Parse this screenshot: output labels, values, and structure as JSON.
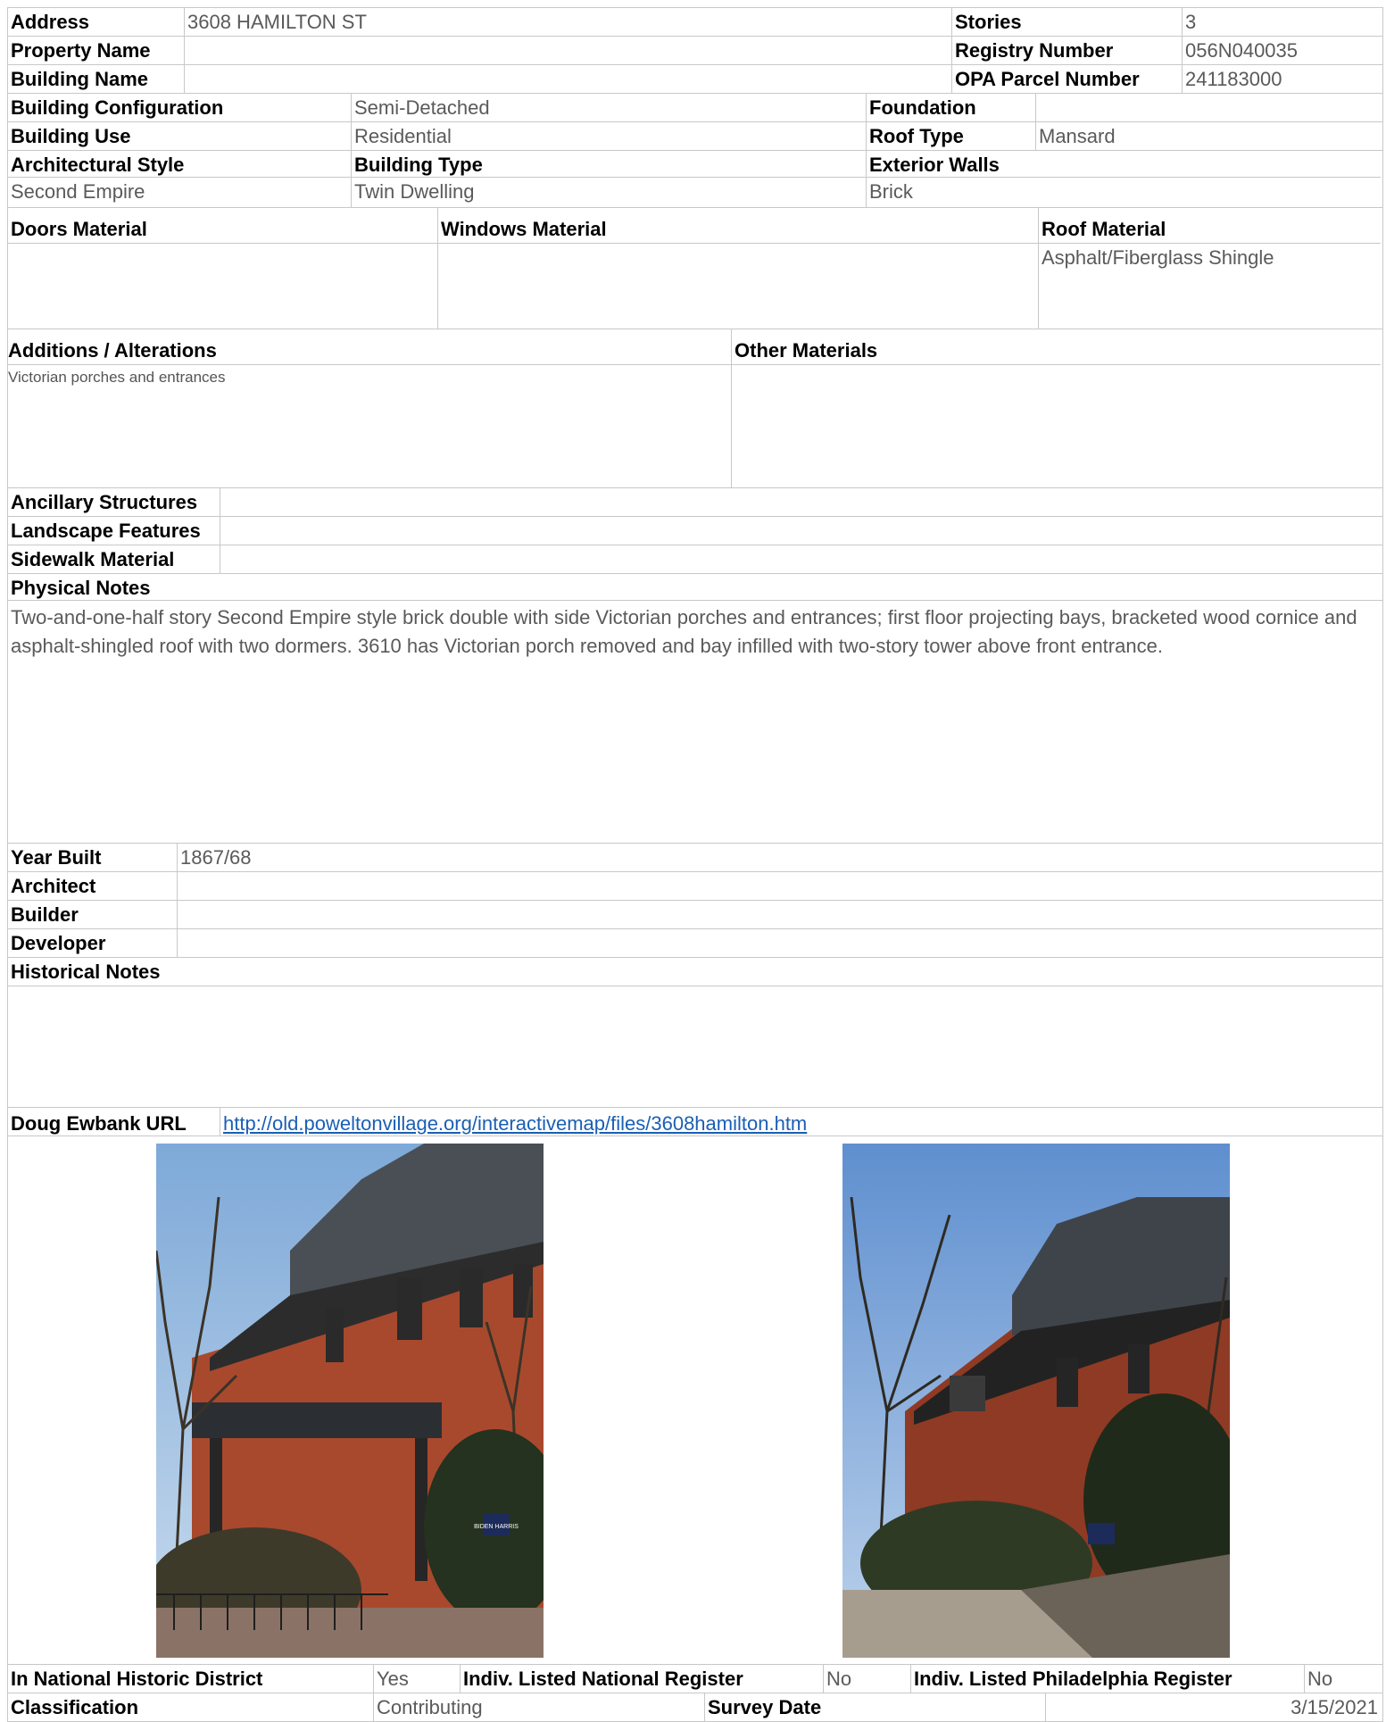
{
  "header": {
    "address_label": "Address",
    "address": "3608 HAMILTON ST",
    "stories_label": "Stories",
    "stories": "3",
    "property_name_label": "Property Name",
    "property_name": "",
    "registry_label": "Registry Number",
    "registry": "056N040035",
    "building_name_label": "Building Name",
    "building_name": "",
    "opa_label": "OPA Parcel Number",
    "opa": "241183000"
  },
  "config": {
    "config_label": "Building Configuration",
    "config": "Semi-Detached",
    "foundation_label": "Foundation",
    "foundation": "",
    "use_label": "Building Use",
    "use": "Residential",
    "roof_type_label": "Roof Type",
    "roof_type": "Mansard",
    "style_label": "Architectural Style",
    "style": "Second Empire",
    "type_label": "Building Type",
    "type": "Twin Dwelling",
    "walls_label": "Exterior Walls",
    "walls": "Brick"
  },
  "materials": {
    "doors_label": "Doors Material",
    "doors": "",
    "windows_label": "Windows Material",
    "windows": "",
    "roof_label": "Roof Material",
    "roof": "Asphalt/Fiberglass Shingle"
  },
  "alterations": {
    "additions_label": "Additions / Alterations",
    "additions": "Victorian porches and entrances",
    "other_label": "Other Materials",
    "other": ""
  },
  "features": {
    "ancillary_label": "Ancillary Structures",
    "ancillary": "",
    "landscape_label": "Landscape Features",
    "landscape": "",
    "sidewalk_label": "Sidewalk Material",
    "sidewalk": ""
  },
  "physical": {
    "label": "Physical Notes",
    "text": "Two-and-one-half story Second Empire style brick double with side Victorian porches and entrances; first floor projecting bays, bracketed wood cornice and asphalt-shingled roof with two dormers. 3610 has Victorian porch removed and bay infilled with two-story tower above front entrance."
  },
  "history": {
    "year_label": "Year Built",
    "year": "1867/68",
    "architect_label": "Architect",
    "architect": "",
    "builder_label": "Builder",
    "builder": "",
    "developer_label": "Developer",
    "developer": "",
    "notes_label": "Historical Notes",
    "notes": ""
  },
  "url": {
    "label": "Doug Ewbank URL",
    "href": "http://old.poweltonvillage.org/interactivemap/files/3608hamilton.htm"
  },
  "photos": {
    "left_alt": "Photo of 3608 Hamilton St, side view with Victorian porch",
    "right_alt": "Photo of 3608 Hamilton St, corner view",
    "sign_text": "BIDEN HARRIS"
  },
  "status": {
    "district_label": "In National Historic District",
    "district": "Yes",
    "national_label": "Indiv. Listed National Register",
    "national": "No",
    "phila_label": "Indiv. Listed Philadelphia Register",
    "phila": "No",
    "class_label": "Classification",
    "class": "Contributing",
    "survey_label": "Survey Date",
    "survey": "3/15/2021"
  },
  "colors": {
    "border": "#c8c8c8",
    "value_text": "#5a5a5a",
    "link": "#1a5fb4"
  }
}
